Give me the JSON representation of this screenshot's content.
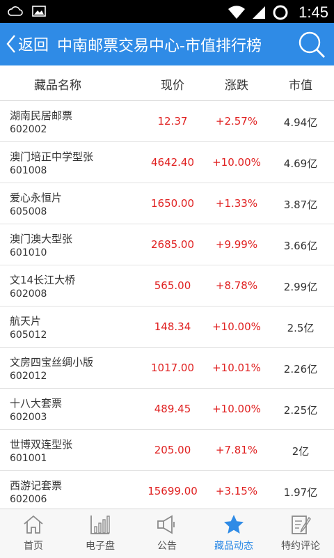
{
  "status_bar": {
    "time": "1:45",
    "icons": [
      "cloud-icon",
      "image-icon",
      "wifi-icon",
      "signal-icon",
      "sync-icon"
    ]
  },
  "header": {
    "back_label": "返回",
    "title": "中南邮票交易中心-市值排行榜",
    "search_icon": "search-icon",
    "color": "#2f8be6"
  },
  "table": {
    "columns": [
      "藏品名称",
      "现价",
      "涨跌",
      "市值"
    ],
    "rows": [
      {
        "name": "湖南民居邮票",
        "code": "602002",
        "price": "12.37",
        "change": "+2.57%",
        "cap": "4.94亿"
      },
      {
        "name": "澳门培正中学型张",
        "code": "601008",
        "price": "4642.40",
        "change": "+10.00%",
        "cap": "4.69亿"
      },
      {
        "name": "爱心永恒片",
        "code": "605008",
        "price": "1650.00",
        "change": "+1.33%",
        "cap": "3.87亿"
      },
      {
        "name": "澳门澳大型张",
        "code": "601010",
        "price": "2685.00",
        "change": "+9.99%",
        "cap": "3.66亿"
      },
      {
        "name": "文14长江大桥",
        "code": "602008",
        "price": "565.00",
        "change": "+8.78%",
        "cap": "2.99亿"
      },
      {
        "name": "航天片",
        "code": "605012",
        "price": "148.34",
        "change": "+10.00%",
        "cap": "2.5亿"
      },
      {
        "name": "文房四宝丝绸小版",
        "code": "602012",
        "price": "1017.00",
        "change": "+10.01%",
        "cap": "2.26亿"
      },
      {
        "name": "十八大套票",
        "code": "602003",
        "price": "489.45",
        "change": "+10.00%",
        "cap": "2.25亿"
      },
      {
        "name": "世博双连型张",
        "code": "601001",
        "price": "205.00",
        "change": "+7.81%",
        "cap": "2亿"
      },
      {
        "name": "西游记套票",
        "code": "602006",
        "price": "15699.00",
        "change": "+3.15%",
        "cap": "1.97亿"
      }
    ],
    "up_color": "#e02020"
  },
  "bottom_nav": {
    "items": [
      {
        "label": "首页",
        "icon": "home-icon"
      },
      {
        "label": "电子盘",
        "icon": "chart-icon"
      },
      {
        "label": "公告",
        "icon": "megaphone-icon"
      },
      {
        "label": "藏品动态",
        "icon": "star-icon"
      },
      {
        "label": "特约评论",
        "icon": "edit-note-icon"
      }
    ],
    "active_index": 3,
    "active_color": "#2f8be6"
  }
}
